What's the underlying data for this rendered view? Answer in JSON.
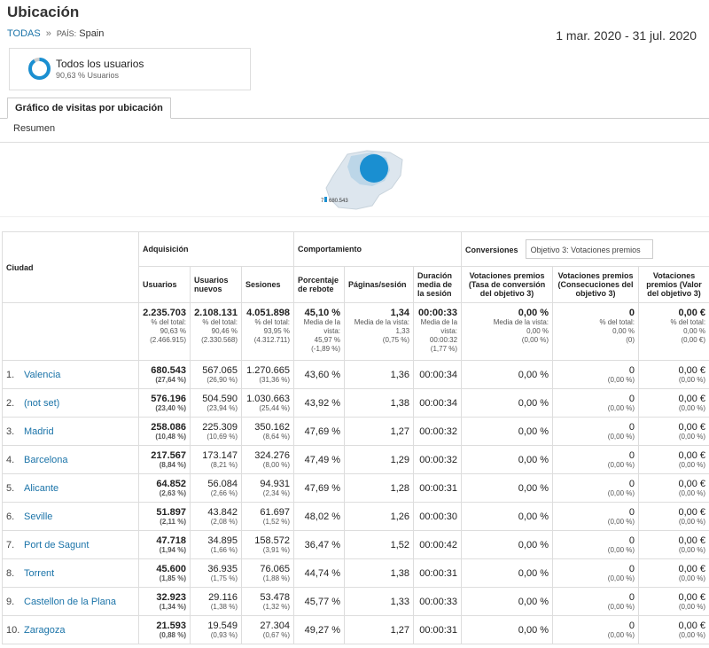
{
  "page": {
    "title": "Ubicación",
    "breadcrumb_all": "TODAS",
    "breadcrumb_sep": "»",
    "breadcrumb_country_label": "PAÍS:",
    "breadcrumb_country": "Spain",
    "date_range": "1 mar. 2020 - 31 jul. 2020"
  },
  "segment": {
    "name": "Todos los usuarios",
    "sub": "90,63 % Usuarios",
    "ring_fraction": 0.9063,
    "color": "#1a8fd1"
  },
  "tab": "Gráfico de visitas por ubicación",
  "subnav": "Resumen",
  "map_legend": {
    "min": "7",
    "max": "680.543"
  },
  "table": {
    "dimension": "Ciudad",
    "groups": {
      "acq": "Adquisición",
      "beh": "Comportamiento",
      "conv": "Conversiones",
      "conv_select": "Objetivo 3: Votaciones premios"
    },
    "columns": {
      "users": "Usuarios",
      "new_users": "Usuarios nuevos",
      "sessions": "Sesiones",
      "bounce": "Porcentaje de rebote",
      "pages": "Páginas/sesión",
      "duration": "Duración media de la sesión",
      "conv_rate": "Votaciones premios (Tasa de conversión del objetivo 3)",
      "completions": "Votaciones premios (Consecuciones del objetivo 3)",
      "value": "Votaciones premios (Valor del objetivo 3)"
    },
    "totals": {
      "users": {
        "v": "2.235.703",
        "s1": "% del total:",
        "s2": "90,63 %",
        "s3": "(2.466.915)"
      },
      "new_users": {
        "v": "2.108.131",
        "s1": "% del total:",
        "s2": "90,46 %",
        "s3": "(2.330.568)"
      },
      "sessions": {
        "v": "4.051.898",
        "s1": "% del total:",
        "s2": "93,95 %",
        "s3": "(4.312.711)"
      },
      "bounce": {
        "v": "45,10 %",
        "s1": "Media de la vista:",
        "s2": "45,97 %",
        "s3": "(-1,89 %)"
      },
      "pages": {
        "v": "1,34",
        "s1": "Media de la vista:",
        "s2": "1,33",
        "s3": "(0,75 %)"
      },
      "duration": {
        "v": "00:00:33",
        "s1": "Media de la vista:",
        "s2": "00:00:32",
        "s3": "(1,77 %)"
      },
      "conv_rate": {
        "v": "0,00 %",
        "s1": "Media de la vista:",
        "s2": "0,00 %",
        "s3": "(0,00 %)"
      },
      "completions": {
        "v": "0",
        "s1": "% del total:",
        "s2": "0,00 %",
        "s3": "(0)"
      },
      "value": {
        "v": "0,00 €",
        "s1": "% del total:",
        "s2": "0,00 %",
        "s3": "(0,00 €)"
      }
    },
    "rows": [
      {
        "idx": "1.",
        "city": "Valencia",
        "users": "680.543",
        "users_p": "(27,64 %)",
        "new_users": "567.065",
        "new_users_p": "(26,90 %)",
        "sessions": "1.270.665",
        "sessions_p": "(31,36 %)",
        "bounce": "43,60 %",
        "pages": "1,36",
        "duration": "00:00:34",
        "conv_rate": "0,00 %",
        "completions": "0",
        "completions_p": "(0,00 %)",
        "value": "0,00 €",
        "value_p": "(0,00 %)"
      },
      {
        "idx": "2.",
        "city": "(not set)",
        "users": "576.196",
        "users_p": "(23,40 %)",
        "new_users": "504.590",
        "new_users_p": "(23,94 %)",
        "sessions": "1.030.663",
        "sessions_p": "(25,44 %)",
        "bounce": "43,92 %",
        "pages": "1,38",
        "duration": "00:00:34",
        "conv_rate": "0,00 %",
        "completions": "0",
        "completions_p": "(0,00 %)",
        "value": "0,00 €",
        "value_p": "(0,00 %)"
      },
      {
        "idx": "3.",
        "city": "Madrid",
        "users": "258.086",
        "users_p": "(10,48 %)",
        "new_users": "225.309",
        "new_users_p": "(10,69 %)",
        "sessions": "350.162",
        "sessions_p": "(8,64 %)",
        "bounce": "47,69 %",
        "pages": "1,27",
        "duration": "00:00:32",
        "conv_rate": "0,00 %",
        "completions": "0",
        "completions_p": "(0,00 %)",
        "value": "0,00 €",
        "value_p": "(0,00 %)"
      },
      {
        "idx": "4.",
        "city": "Barcelona",
        "users": "217.567",
        "users_p": "(8,84 %)",
        "new_users": "173.147",
        "new_users_p": "(8,21 %)",
        "sessions": "324.276",
        "sessions_p": "(8,00 %)",
        "bounce": "47,49 %",
        "pages": "1,29",
        "duration": "00:00:32",
        "conv_rate": "0,00 %",
        "completions": "0",
        "completions_p": "(0,00 %)",
        "value": "0,00 €",
        "value_p": "(0,00 %)"
      },
      {
        "idx": "5.",
        "city": "Alicante",
        "users": "64.852",
        "users_p": "(2,63 %)",
        "new_users": "56.084",
        "new_users_p": "(2,66 %)",
        "sessions": "94.931",
        "sessions_p": "(2,34 %)",
        "bounce": "47,69 %",
        "pages": "1,28",
        "duration": "00:00:31",
        "conv_rate": "0,00 %",
        "completions": "0",
        "completions_p": "(0,00 %)",
        "value": "0,00 €",
        "value_p": "(0,00 %)"
      },
      {
        "idx": "6.",
        "city": "Seville",
        "users": "51.897",
        "users_p": "(2,11 %)",
        "new_users": "43.842",
        "new_users_p": "(2,08 %)",
        "sessions": "61.697",
        "sessions_p": "(1,52 %)",
        "bounce": "48,02 %",
        "pages": "1,26",
        "duration": "00:00:30",
        "conv_rate": "0,00 %",
        "completions": "0",
        "completions_p": "(0,00 %)",
        "value": "0,00 €",
        "value_p": "(0,00 %)"
      },
      {
        "idx": "7.",
        "city": "Port de Sagunt",
        "users": "47.718",
        "users_p": "(1,94 %)",
        "new_users": "34.895",
        "new_users_p": "(1,66 %)",
        "sessions": "158.572",
        "sessions_p": "(3,91 %)",
        "bounce": "36,47 %",
        "pages": "1,52",
        "duration": "00:00:42",
        "conv_rate": "0,00 %",
        "completions": "0",
        "completions_p": "(0,00 %)",
        "value": "0,00 €",
        "value_p": "(0,00 %)"
      },
      {
        "idx": "8.",
        "city": "Torrent",
        "users": "45.600",
        "users_p": "(1,85 %)",
        "new_users": "36.935",
        "new_users_p": "(1,75 %)",
        "sessions": "76.065",
        "sessions_p": "(1,88 %)",
        "bounce": "44,74 %",
        "pages": "1,38",
        "duration": "00:00:31",
        "conv_rate": "0,00 %",
        "completions": "0",
        "completions_p": "(0,00 %)",
        "value": "0,00 €",
        "value_p": "(0,00 %)"
      },
      {
        "idx": "9.",
        "city": "Castellon de la Plana",
        "users": "32.923",
        "users_p": "(1,34 %)",
        "new_users": "29.116",
        "new_users_p": "(1,38 %)",
        "sessions": "53.478",
        "sessions_p": "(1,32 %)",
        "bounce": "45,77 %",
        "pages": "1,33",
        "duration": "00:00:33",
        "conv_rate": "0,00 %",
        "completions": "0",
        "completions_p": "(0,00 %)",
        "value": "0,00 €",
        "value_p": "(0,00 %)"
      },
      {
        "idx": "10.",
        "city": "Zaragoza",
        "users": "21.593",
        "users_p": "(0,88 %)",
        "new_users": "19.549",
        "new_users_p": "(0,93 %)",
        "sessions": "27.304",
        "sessions_p": "(0,67 %)",
        "bounce": "49,27 %",
        "pages": "1,27",
        "duration": "00:00:31",
        "conv_rate": "0,00 %",
        "completions": "0",
        "completions_p": "(0,00 %)",
        "value": "0,00 €",
        "value_p": "(0,00 %)"
      }
    ]
  },
  "colors": {
    "link": "#1a73a8",
    "accent": "#1a8fd1",
    "map_land": "#dde6ee",
    "map_water": "#c5dbe8"
  }
}
